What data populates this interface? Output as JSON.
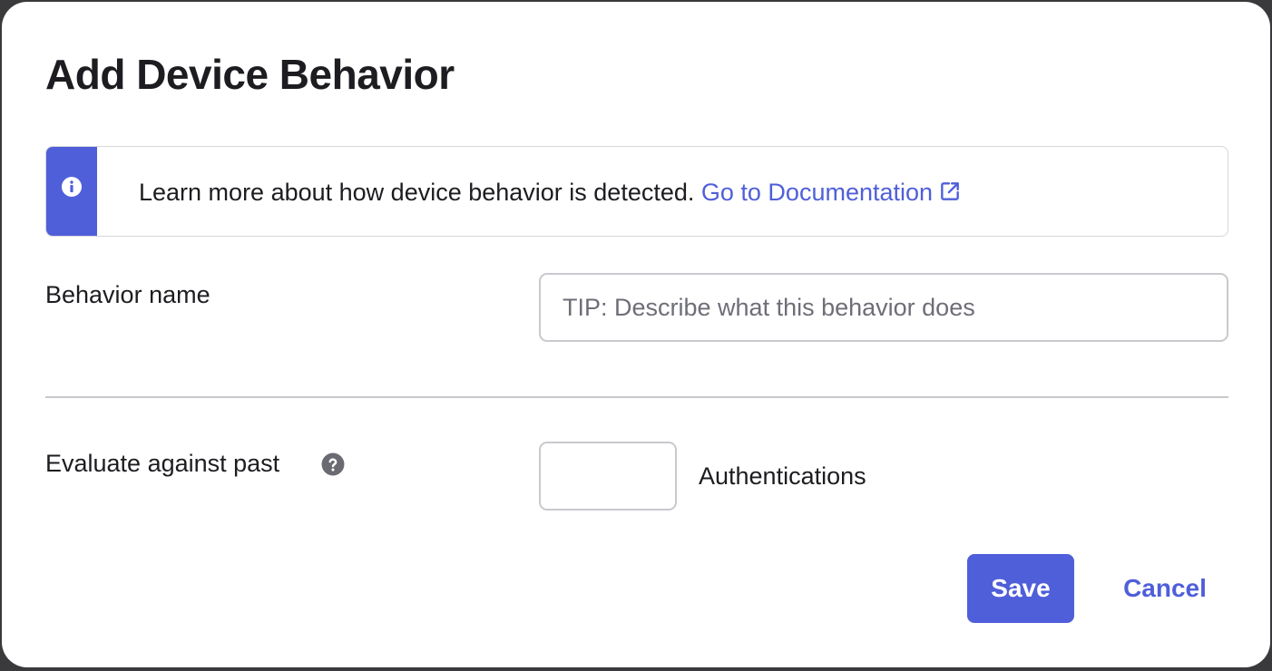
{
  "dialog": {
    "title": "Add Device Behavior",
    "accent_color": "#4f5fd9"
  },
  "callout": {
    "icon": "info-icon",
    "text": "Learn more about how device behavior is detected. ",
    "link_label": "Go to Documentation",
    "link_icon": "external-link-icon"
  },
  "form": {
    "behavior_name": {
      "label": "Behavior name",
      "value": "",
      "placeholder": "TIP: Describe what this behavior does"
    },
    "evaluate_past": {
      "label": "Evaluate against past",
      "help_icon": "question-circle-icon",
      "value": "",
      "unit_label": "Authentications"
    }
  },
  "actions": {
    "save_label": "Save",
    "cancel_label": "Cancel"
  }
}
